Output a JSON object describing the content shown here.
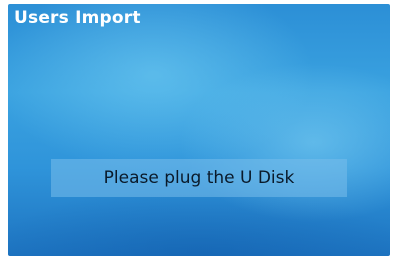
{
  "screen": {
    "title": "Users Import",
    "message": "Please plug the U Disk"
  }
}
